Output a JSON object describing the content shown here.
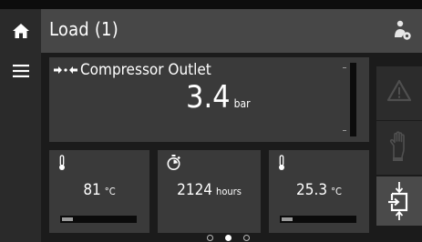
{
  "header": {
    "title": "Load (1)",
    "user_icon": "user-service-icon"
  },
  "nav": {
    "home_icon": "home-icon",
    "menu_icon": "hamburger-menu-icon"
  },
  "main_reading": {
    "icon": "flow-arrows-icon",
    "label": "Compressor Outlet",
    "value": "3.4",
    "unit": "bar"
  },
  "side_buttons": [
    {
      "icon": "warning-icon",
      "enabled": false
    },
    {
      "icon": "service-glove-icon",
      "enabled": false
    },
    {
      "icon": "load-unload-icon",
      "enabled": true
    }
  ],
  "tiles": [
    {
      "icon": "thermometer-icon",
      "value": "81",
      "unit": "°C",
      "level": 0.15
    },
    {
      "icon": "stopwatch-icon",
      "value": "2124",
      "unit": "hours",
      "level": null
    },
    {
      "icon": "thermometer-icon",
      "value": "25.3",
      "unit": "°C",
      "level": 0.15
    }
  ],
  "pager": {
    "count": 3,
    "active": 1
  },
  "colors": {
    "background": "#1b1b1b",
    "header": "#474747",
    "panel": "#3a3a3a",
    "gauge_fill": "#9a9a9a"
  }
}
